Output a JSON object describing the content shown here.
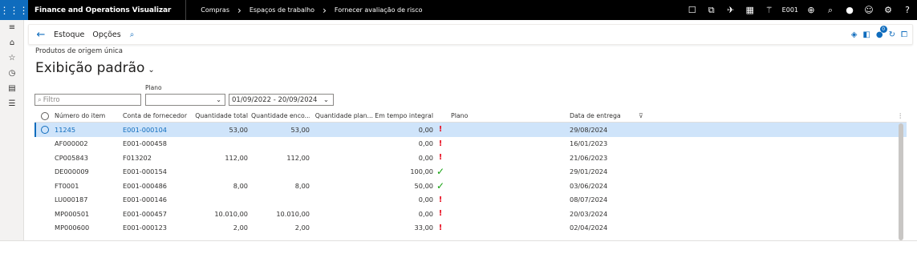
{
  "topbar": {
    "app_name": "Finance and Operations Visualizar",
    "breadcrumbs": [
      "Compras",
      "Espaços de trabalho",
      "Fornecer avaliação de risco"
    ],
    "company": "E001",
    "icons": [
      "app-launcher-icon",
      "square-icon",
      "copy-icon",
      "rocket-icon",
      "calculator-icon",
      "magic-wand-icon",
      "globe-icon",
      "search-icon",
      "lightbulb-icon",
      "smiley-icon",
      "gear-icon",
      "help-icon"
    ]
  },
  "rail": {
    "icons": [
      "hamburger-icon",
      "home-icon",
      "star-icon",
      "clock-icon",
      "workspace-icon",
      "list-icon"
    ]
  },
  "actionbar": {
    "items": [
      "Estoque",
      "Opções"
    ],
    "notification_count": "0"
  },
  "page": {
    "subtitle": "Produtos de origem única",
    "view_title": "Exibição padrão"
  },
  "filters": {
    "search_placeholder": "Filtro",
    "plano_label": "Plano",
    "plano_value": "",
    "date_range": "01/09/2022 - 20/09/2024"
  },
  "grid": {
    "columns": [
      "Número do item",
      "Conta de fornecedor",
      "Quantidade total",
      "Quantidade enco...",
      "Quantidade plan...",
      "Em tempo integral",
      "Plano",
      "Data de entrega"
    ],
    "rows": [
      {
        "item": "11245",
        "vendor": "E001-000104",
        "qtotal": "53,00",
        "qenc": "53,00",
        "qplan": "",
        "tempo": "0,00",
        "status": "red",
        "plano": "",
        "data": "29/08/2024"
      },
      {
        "item": "AF000002",
        "vendor": "E001-000458",
        "qtotal": "",
        "qenc": "",
        "qplan": "",
        "tempo": "0,00",
        "status": "red",
        "plano": "",
        "data": "16/01/2023"
      },
      {
        "item": "CP005843",
        "vendor": "F013202",
        "qtotal": "112,00",
        "qenc": "112,00",
        "qplan": "",
        "tempo": "0,00",
        "status": "red",
        "plano": "",
        "data": "21/06/2023"
      },
      {
        "item": "DE000009",
        "vendor": "E001-000154",
        "qtotal": "",
        "qenc": "",
        "qplan": "",
        "tempo": "100,00",
        "status": "green",
        "plano": "",
        "data": "29/01/2024"
      },
      {
        "item": "FT0001",
        "vendor": "E001-000486",
        "qtotal": "8,00",
        "qenc": "8,00",
        "qplan": "",
        "tempo": "50,00",
        "status": "green",
        "plano": "",
        "data": "03/06/2024"
      },
      {
        "item": "LU000187",
        "vendor": "E001-000146",
        "qtotal": "",
        "qenc": "",
        "qplan": "",
        "tempo": "0,00",
        "status": "red",
        "plano": "",
        "data": "08/07/2024"
      },
      {
        "item": "MP000501",
        "vendor": "E001-000457",
        "qtotal": "10.010,00",
        "qenc": "10.010,00",
        "qplan": "",
        "tempo": "0,00",
        "status": "red",
        "plano": "",
        "data": "20/03/2024"
      },
      {
        "item": "MP000600",
        "vendor": "E001-000123",
        "qtotal": "2,00",
        "qenc": "2,00",
        "qplan": "",
        "tempo": "33,00",
        "status": "red",
        "plano": "",
        "data": "02/04/2024"
      }
    ]
  },
  "colors": {
    "accent": "#0f6cbd",
    "topbar": "#000000",
    "selected_row": "#cfe4fa",
    "status_red": "#e81123",
    "status_green": "#13a10e"
  }
}
